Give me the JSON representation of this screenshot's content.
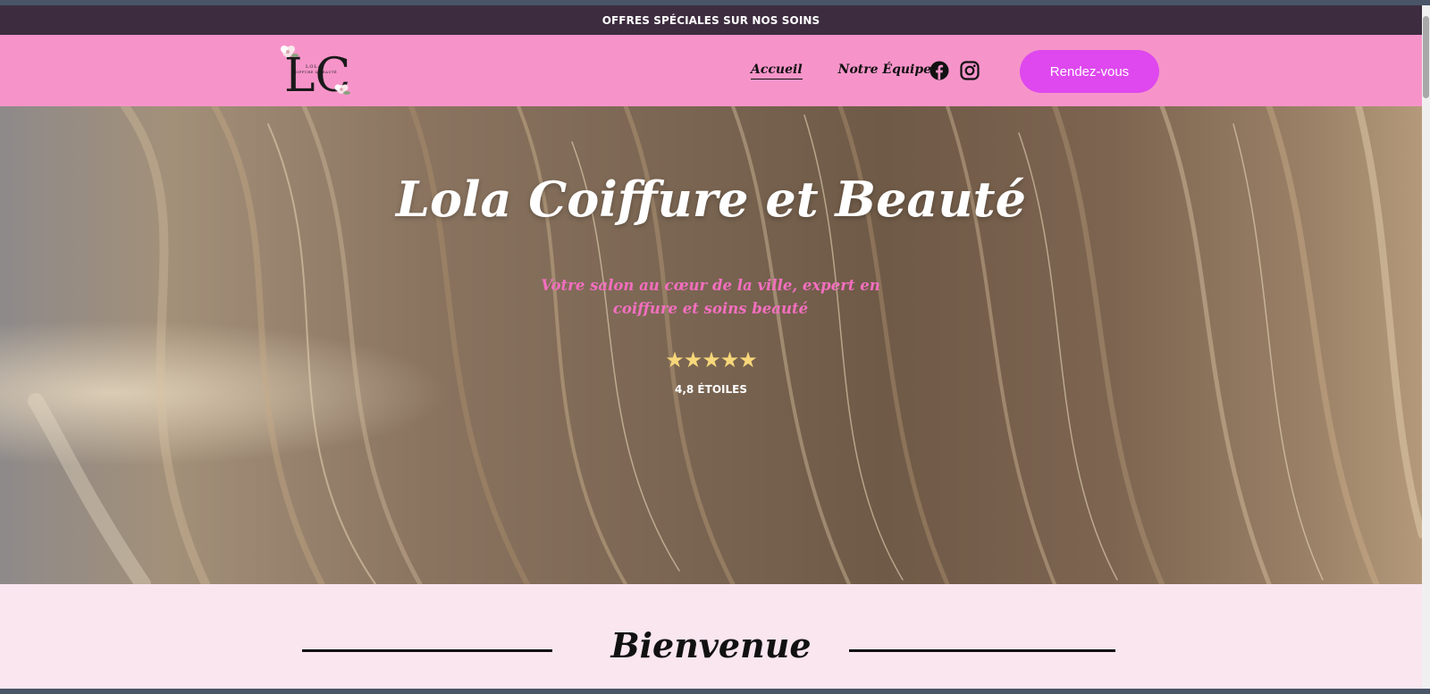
{
  "promo": {
    "text": "OFFRES SPÉCIALES SUR NOS SOINS"
  },
  "logo": {
    "initials": "LC",
    "name": "LOLA",
    "tagline": "COIFFURE & BEAUTÉ"
  },
  "nav": {
    "items": [
      {
        "label": "Accueil",
        "active": true
      },
      {
        "label": "Notre Équipe",
        "active": false
      }
    ]
  },
  "social": {
    "icons": [
      "facebook-icon",
      "instagram-icon"
    ]
  },
  "cta": {
    "label": "Rendez-vous"
  },
  "hero": {
    "title": "Lola Coiffure et Beauté",
    "subtitle": "Votre salon au cœur de la ville, expert en coiffure et soins beauté",
    "stars": "★★★★★",
    "rating": "4,8 ÉTOILES"
  },
  "welcome": {
    "title": "Bienvenue"
  },
  "colors": {
    "promo_bg": "#3d2c3f",
    "header_bg": "#f694c9",
    "cta_bg": "#de48ee",
    "subtitle": "#f36fbf",
    "star": "#f7d77a",
    "section_bg": "#f9e6ef"
  }
}
